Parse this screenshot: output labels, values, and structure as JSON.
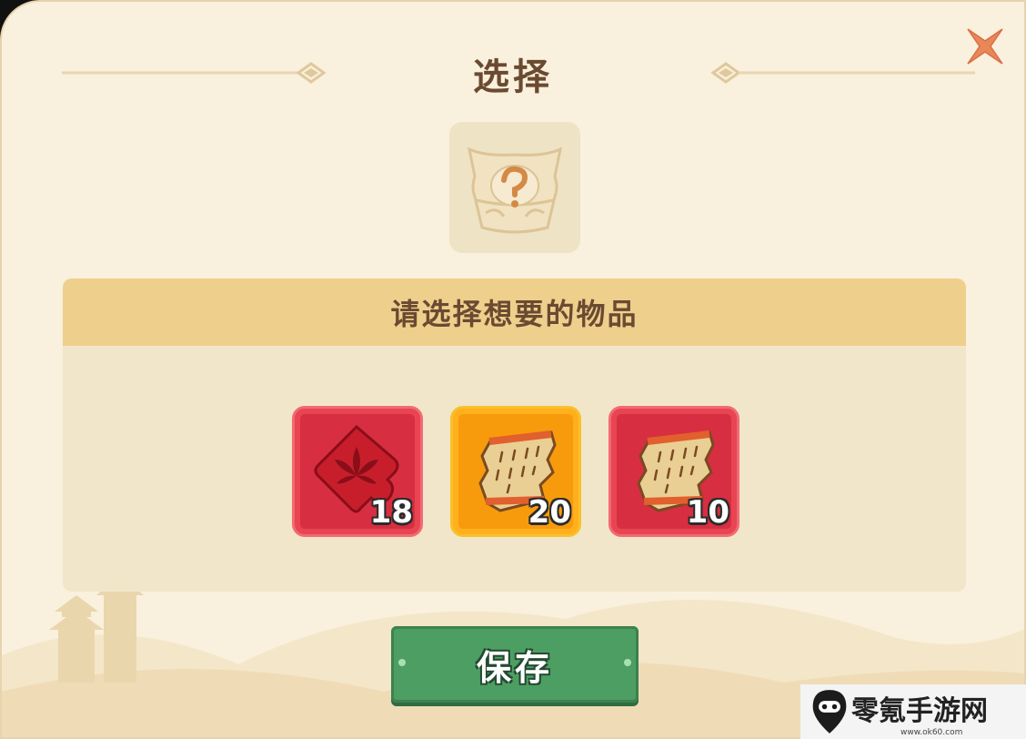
{
  "dialog": {
    "title": "选择",
    "subtitle": "请选择想要的物品",
    "close_icon": "close-x-icon",
    "chest_icon": "mystery-chest-icon"
  },
  "items": [
    {
      "icon": "red-lotus-puzzle-piece-icon",
      "count": "18",
      "frame": "red"
    },
    {
      "icon": "scroll-fragment-icon",
      "count": "20",
      "frame": "orange"
    },
    {
      "icon": "scroll-fragment-icon",
      "count": "10",
      "frame": "red"
    }
  ],
  "save_button": {
    "label": "保存"
  },
  "watermark": {
    "text": "零氪手游网",
    "url": "www.ok60.com"
  },
  "colors": {
    "background": "#f9f0dd",
    "panel_header": "#efcf8c",
    "panel_body": "#f1e6c9",
    "title_text": "#6a4a31",
    "item_red": "#d72e41",
    "item_orange": "#f79b0d",
    "save_green": "#4d9e63",
    "close_orange": "#ea8759"
  }
}
